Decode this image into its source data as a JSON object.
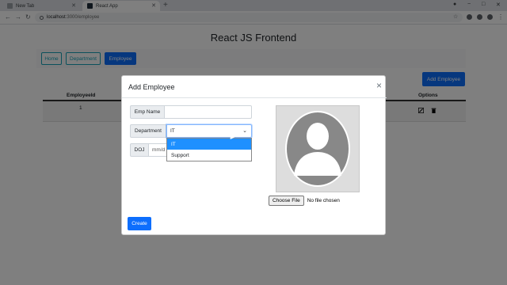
{
  "browser": {
    "tabs": [
      {
        "label": "New Tab",
        "active": false
      },
      {
        "label": "React App",
        "active": true
      }
    ],
    "new_tab_label": "+",
    "url_host": "localhost",
    "url_path": ":3000/employee",
    "window_controls": [
      "−",
      "□",
      "✕"
    ]
  },
  "page": {
    "title": "React JS Frontend",
    "nav": [
      {
        "label": "Home",
        "active": false
      },
      {
        "label": "Department",
        "active": false
      },
      {
        "label": "Employee",
        "active": true
      }
    ],
    "add_button_label": "Add Employee",
    "table": {
      "headers": [
        "EmployeeId",
        "Options"
      ],
      "rows": [
        {
          "id": "1"
        }
      ]
    }
  },
  "modal": {
    "title": "Add Employee",
    "close_label": "×",
    "fields": {
      "emp_name_label": "Emp Name",
      "emp_name_value": "",
      "department_label": "Department",
      "department_value": "IT",
      "doj_label": "DOJ",
      "doj_placeholder": "mm/d"
    },
    "department_options": [
      {
        "label": "IT",
        "selected": true
      },
      {
        "label": "Support",
        "selected": false
      }
    ],
    "choose_file_label": "Choose File",
    "no_file_text": "No file chosen",
    "create_label": "Create"
  },
  "colors": {
    "primary": "#0d6efd",
    "info": "#17a2b8",
    "dropdown_highlight": "#1e90ff"
  },
  "icons": [
    "back-arrow-icon",
    "forward-arrow-icon",
    "reload-icon",
    "star-icon",
    "edit-icon",
    "trash-icon",
    "avatar-placeholder-icon",
    "close-icon",
    "chevron-down-icon"
  ]
}
